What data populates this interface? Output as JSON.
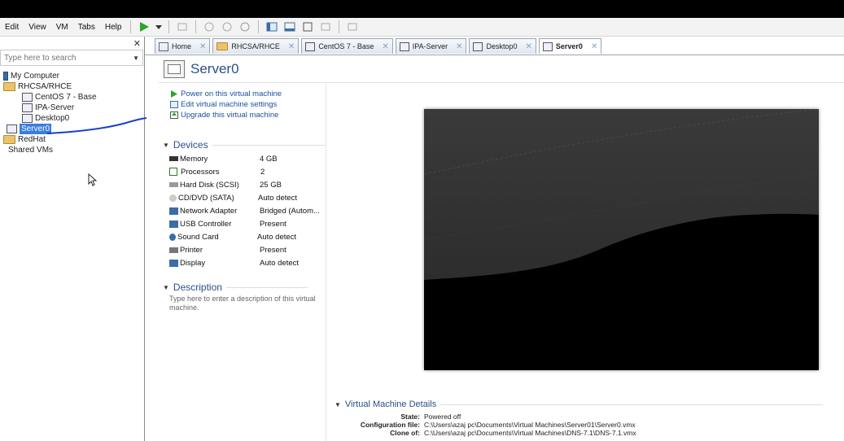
{
  "menu": [
    "Edit",
    "View",
    "VM",
    "Tabs",
    "Help"
  ],
  "library": {
    "search_placeholder": "Type here to search",
    "tree": [
      {
        "label": "My Computer",
        "indent": 0,
        "icon": "computer-icon"
      },
      {
        "label": "RHCSA/RHCE",
        "indent": 0,
        "icon": "folder-icon"
      },
      {
        "label": "CentOS 7 - Base",
        "indent": 1,
        "icon": "vm-icon"
      },
      {
        "label": "IPA-Server",
        "indent": 1,
        "icon": "vm-icon"
      },
      {
        "label": "Desktop0",
        "indent": 1,
        "icon": "vm-icon"
      },
      {
        "label": "Server0",
        "indent": 0,
        "icon": "vm-icon",
        "selected": true
      },
      {
        "label": "RedHat",
        "indent": 0,
        "icon": "folder-icon"
      },
      {
        "label": "Shared VMs",
        "indent": 0,
        "icon": "shared-icon"
      }
    ]
  },
  "tabs": [
    {
      "label": "Home",
      "active": false,
      "icon": "home-icon"
    },
    {
      "label": "RHCSA/RHCE",
      "active": false,
      "icon": "folder-icon"
    },
    {
      "label": "CentOS 7 - Base",
      "active": false,
      "icon": "vm-icon"
    },
    {
      "label": "IPA-Server",
      "active": false,
      "icon": "vm-icon"
    },
    {
      "label": "Desktop0",
      "active": false,
      "icon": "vm-icon"
    },
    {
      "label": "Server0",
      "active": true,
      "icon": "vm-icon"
    }
  ],
  "vm": {
    "name": "Server0",
    "actions": [
      {
        "label": "Power on this virtual machine",
        "icon": "play-icon"
      },
      {
        "label": "Edit virtual machine settings",
        "icon": "settings-icon"
      },
      {
        "label": "Upgrade this virtual machine",
        "icon": "upgrade-icon"
      }
    ],
    "devices_header": "Devices",
    "devices": [
      {
        "name": "Memory",
        "value": "4 GB",
        "icon": "memory-icon"
      },
      {
        "name": "Processors",
        "value": "2",
        "icon": "processor-icon"
      },
      {
        "name": "Hard Disk (SCSI)",
        "value": "25 GB",
        "icon": "harddisk-icon"
      },
      {
        "name": "CD/DVD (SATA)",
        "value": "Auto detect",
        "icon": "cdrom-icon"
      },
      {
        "name": "Network Adapter",
        "value": "Bridged (Autom...",
        "icon": "network-icon"
      },
      {
        "name": "USB Controller",
        "value": "Present",
        "icon": "usb-icon"
      },
      {
        "name": "Sound Card",
        "value": "Auto detect",
        "icon": "sound-icon"
      },
      {
        "name": "Printer",
        "value": "Present",
        "icon": "printer-icon"
      },
      {
        "name": "Display",
        "value": "Auto detect",
        "icon": "display-icon"
      }
    ],
    "description_header": "Description",
    "description_placeholder": "Type here to enter a description of this virtual machine.",
    "details_header": "Virtual Machine Details",
    "details": [
      {
        "key": "State:",
        "value": "Powered off"
      },
      {
        "key": "Configuration file:",
        "value": "C:\\Users\\azaj pc\\Documents\\Virtual Machines\\Server01\\Server0.vmx"
      },
      {
        "key": "Clone of:",
        "value": "C:\\Users\\azaj pc\\Documents\\Virtual Machines\\DNS-7.1\\DNS-7.1.vmx"
      }
    ]
  },
  "colors": {
    "accent": "#2a4f8a",
    "link": "#1c4fa0",
    "selection": "#3b7ddd",
    "annotation": "#1a3fcf"
  }
}
